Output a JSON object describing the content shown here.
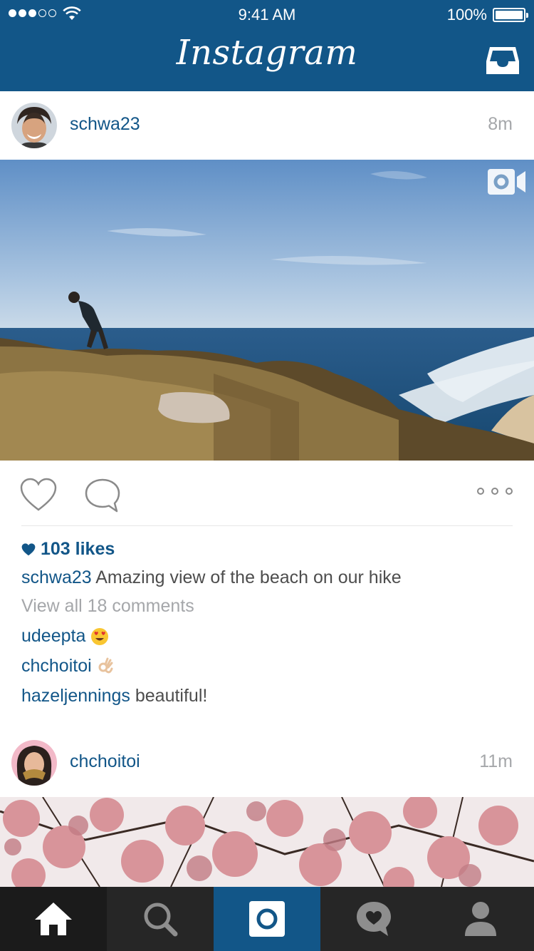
{
  "status_bar": {
    "time": "9:41 AM",
    "battery_pct": "100%"
  },
  "app": {
    "title": "Instagram"
  },
  "posts": [
    {
      "username": "schwa23",
      "time_ago": "8m",
      "likes": "103 likes",
      "caption_user": "schwa23",
      "caption_text": "Amazing view of the beach on our hike",
      "view_comments": "View all 18 comments",
      "comments": [
        {
          "user": "udeepta",
          "text": "",
          "emoji": "heart-eyes-emoji"
        },
        {
          "user": "chchoitoi",
          "text": "",
          "emoji": "ok-hand-emoji"
        },
        {
          "user": "hazeljennings",
          "text": "beautiful!",
          "emoji": ""
        }
      ]
    },
    {
      "username": "chchoitoi",
      "time_ago": "11m"
    }
  ],
  "tabs": [
    "home-icon",
    "search-icon",
    "camera-icon",
    "activity-icon",
    "profile-icon"
  ],
  "colors": {
    "brand_blue": "#125688",
    "tab_bar": "#262626",
    "muted_text": "#a5a7aa"
  }
}
